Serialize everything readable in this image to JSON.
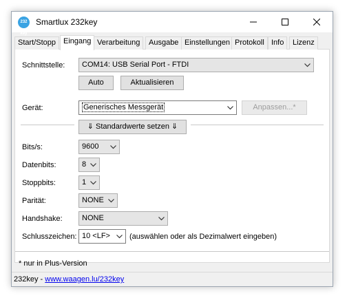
{
  "window": {
    "title": "Smartlux 232key",
    "icon_text": "232 key",
    "icon": "app-round-icon"
  },
  "tabs": [
    {
      "label": "Start/Stopp",
      "active": false
    },
    {
      "label": "Eingang",
      "active": true
    },
    {
      "label": "Verarbeitung",
      "active": false
    },
    {
      "label": "Ausgabe",
      "active": false
    },
    {
      "label": "Einstellungen",
      "active": false
    },
    {
      "label": "Protokoll",
      "active": false
    },
    {
      "label": "Info",
      "active": false
    },
    {
      "label": "Lizenz",
      "active": false
    }
  ],
  "interface": {
    "label": "Schnittstelle:",
    "value": "COM14: USB Serial Port - FTDI",
    "auto_button": "Auto",
    "refresh_button": "Aktualisieren"
  },
  "device": {
    "label": "Gerät:",
    "value": "Generisches Messgerät",
    "customize_button": "Anpassen...*",
    "defaults_button": "⇓ Standardwerte setzen ⇓"
  },
  "fields": {
    "bits": {
      "label": "Bits/s:",
      "value": "9600"
    },
    "databits": {
      "label": "Datenbits:",
      "value": "8"
    },
    "stopbits": {
      "label": "Stoppbits:",
      "value": "1"
    },
    "parity": {
      "label": "Parität:",
      "value": "NONE"
    },
    "handshake": {
      "label": "Handshake:",
      "value": "NONE"
    },
    "terminator": {
      "label": "Schlusszeichen:",
      "value": "10 <LF>",
      "hint": "(auswählen oder als Dezimalwert eingeben)"
    }
  },
  "footnote": "* nur in Plus-Version",
  "status": {
    "prefix": "232key - ",
    "link": "www.waagen.lu/232key"
  },
  "colors": {
    "selection": "#0078d7",
    "link": "#0000ee",
    "app_icon": "#3aa3e3"
  }
}
